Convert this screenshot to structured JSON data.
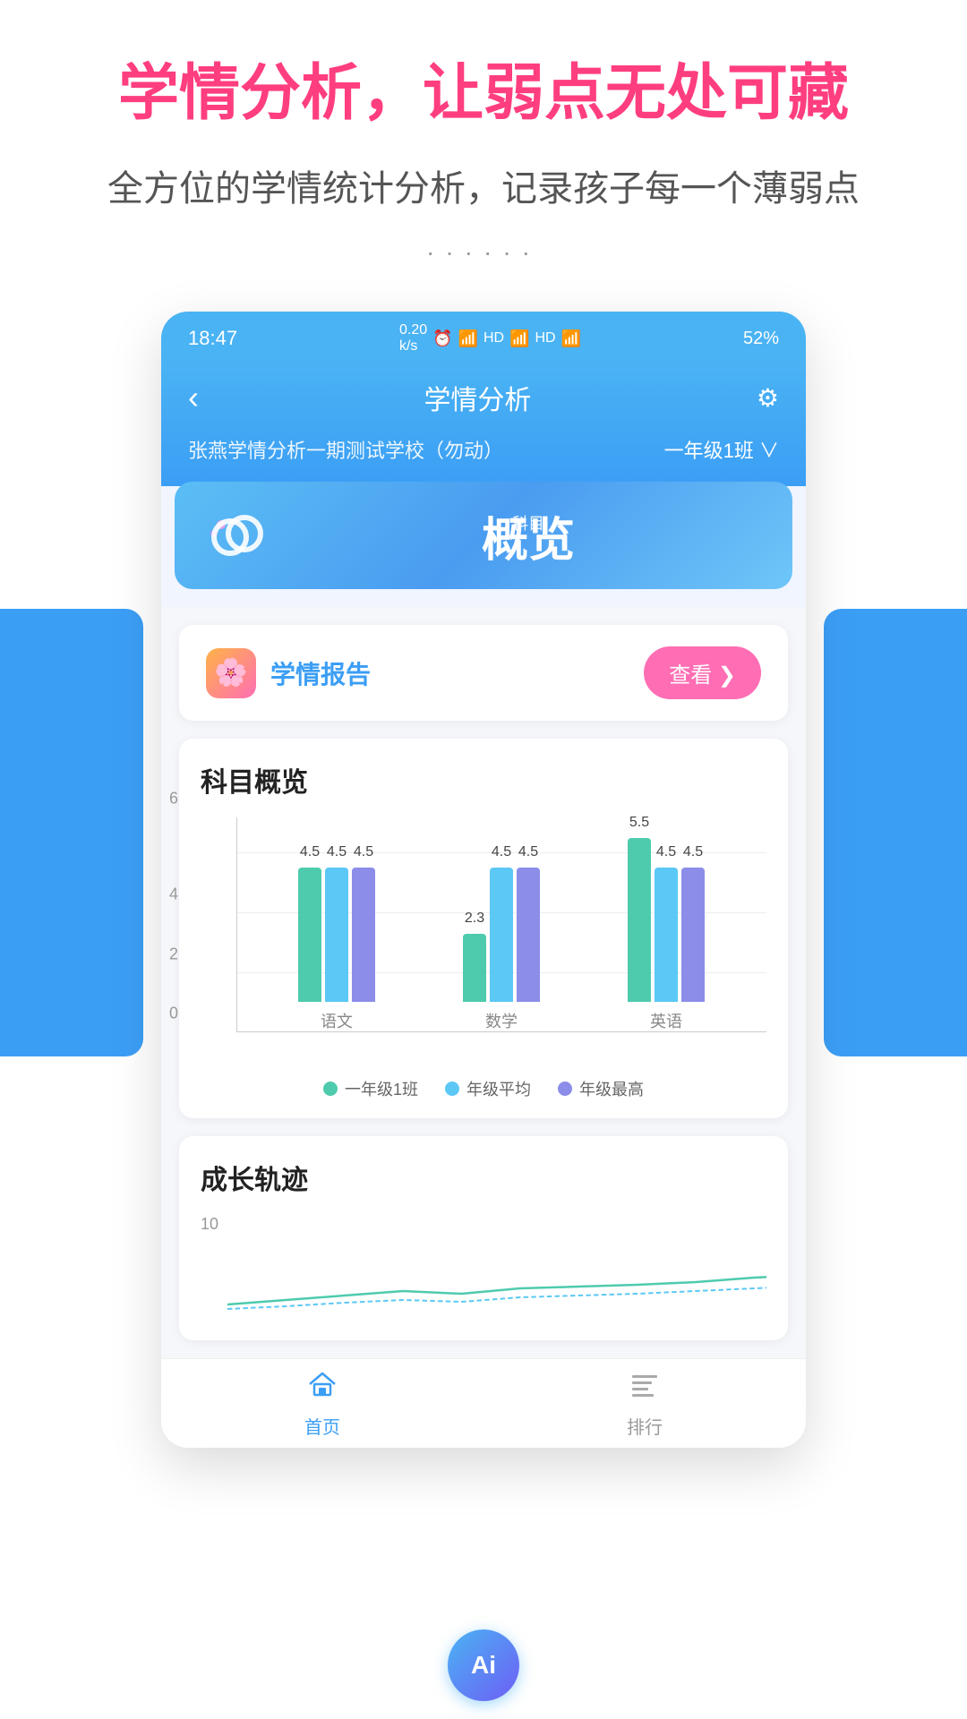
{
  "promo": {
    "title": "学情分析，让弱点无处可藏",
    "subtitle": "全方位的学情统计分析，记录孩子每一个薄弱点",
    "dots": "······"
  },
  "statusBar": {
    "time": "18:47",
    "network": "0.20 k/s",
    "battery": "52%",
    "icons": "▶ ♦ ☰ ♾ HD 4G HD 4G"
  },
  "header": {
    "back": "‹",
    "title": "学情分析",
    "settings": "⚙"
  },
  "school": {
    "name": "张燕学情分析一期测试学校（勿动）",
    "class": "一年级1班 ∨"
  },
  "subjectCard": {
    "label": "科目",
    "mainText": "概览"
  },
  "reportCard": {
    "icon": "🌸",
    "title": "学情报告",
    "viewBtn": "查看 ❯"
  },
  "chartSection": {
    "title": "科目概览",
    "yAxisLabels": [
      "6",
      "4",
      "2",
      "0"
    ],
    "yAxisValues": [
      6,
      4,
      2,
      0
    ],
    "maxY": 6,
    "subjects": [
      {
        "name": "语文",
        "bars": [
          {
            "color": "green",
            "value": 4.5,
            "label": "4.5"
          },
          {
            "color": "blue",
            "value": 4.5,
            "label": "4.5"
          },
          {
            "color": "purple",
            "value": 4.5,
            "label": "4.5"
          }
        ]
      },
      {
        "name": "数学",
        "bars": [
          {
            "color": "green",
            "value": 2.3,
            "label": "2.3"
          },
          {
            "color": "blue",
            "value": 4.5,
            "label": "4.5"
          },
          {
            "color": "purple",
            "value": 4.5,
            "label": "4.5"
          }
        ]
      },
      {
        "name": "英语",
        "bars": [
          {
            "color": "green",
            "value": 5.5,
            "label": "5.5"
          },
          {
            "color": "blue",
            "value": 4.5,
            "label": "4.5"
          },
          {
            "color": "purple",
            "value": 4.5,
            "label": "4.5"
          }
        ]
      }
    ],
    "legend": [
      {
        "color": "#4ecbad",
        "label": "一年级1班"
      },
      {
        "color": "#5bc8f5",
        "label": "年级平均"
      },
      {
        "color": "#8b8de8",
        "label": "年级最高"
      }
    ]
  },
  "growthSection": {
    "title": "成长轨迹",
    "yMax": "10"
  },
  "bottomNav": [
    {
      "label": "首页",
      "active": true,
      "icon": "🏠"
    },
    {
      "label": "排行",
      "active": false,
      "icon": "📋"
    }
  ],
  "aiButton": {
    "label": "Ai"
  }
}
